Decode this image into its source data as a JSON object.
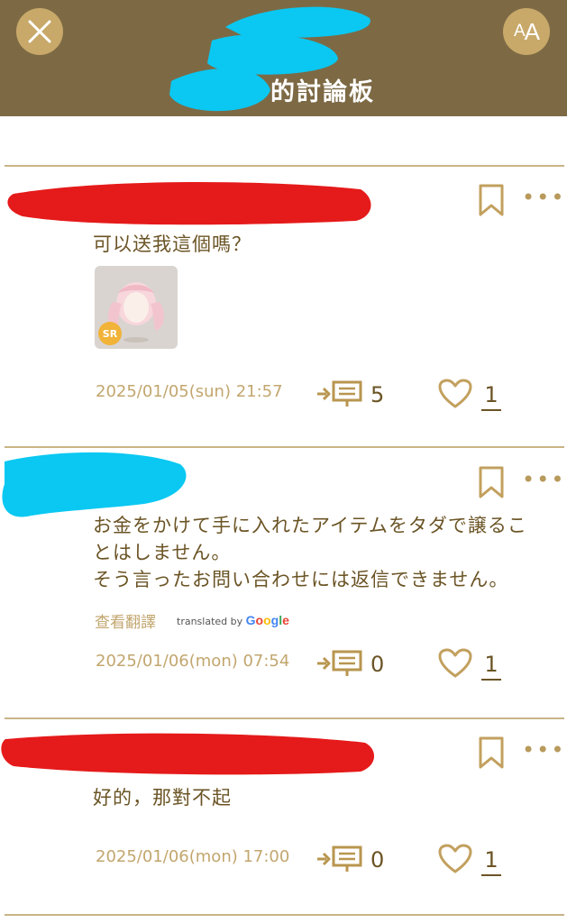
{
  "header": {
    "title_suffix": "的討論板",
    "font_button_big": "A",
    "font_button_small": "A"
  },
  "posts": [
    {
      "text_lines": [
        "可以送我這個嗎？"
      ],
      "badge": "SR",
      "date": "2025/01/05(sun) 21:57",
      "replies": "5",
      "likes": "1"
    },
    {
      "text_lines": [
        "お金をかけて手に入れたアイテムをタダで譲るこ",
        "とはしません。",
        "そう言ったお問い合わせには返信できません。"
      ],
      "translate_link": "查看翻譯",
      "translated_by": "translated by",
      "google": "Google",
      "date": "2025/01/06(mon) 07:54",
      "replies": "0",
      "likes": "1"
    },
    {
      "text_lines": [
        "好的，那對不起"
      ],
      "date": "2025/01/06(mon) 17:00",
      "replies": "0",
      "likes": "1"
    }
  ],
  "colors": {
    "header_bg": "#7d6a45",
    "accent_gold": "#c8a96a",
    "text_brown": "#6b5425",
    "redaction_red": "#e51a1a",
    "redaction_cyan": "#0ac8f2"
  }
}
